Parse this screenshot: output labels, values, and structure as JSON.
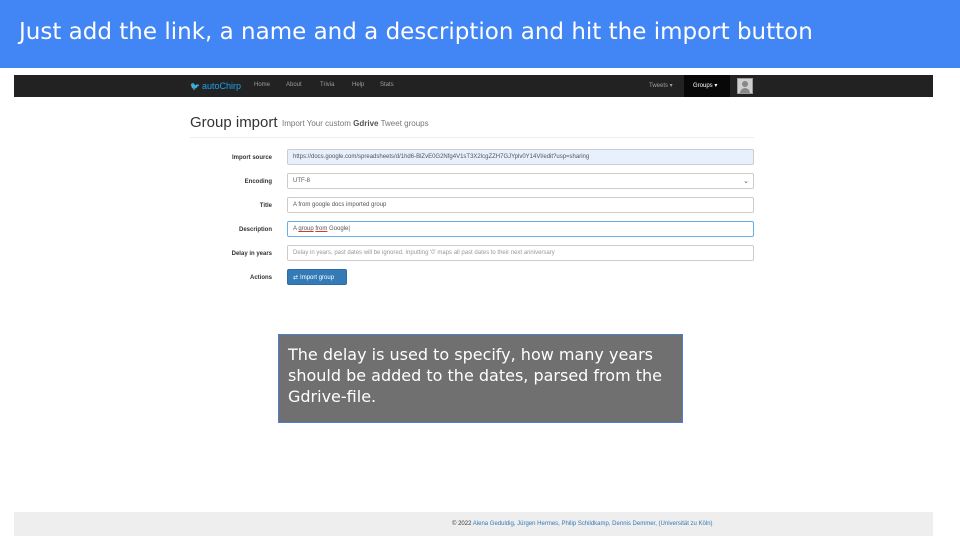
{
  "slide": {
    "title": "Just add the link, a name and a description and hit the import button",
    "note": "The delay is used to specify, how many years\nshould be added to the dates, parsed from the\nGdrive-file."
  },
  "navbar": {
    "brand": "autoChirp",
    "links": [
      "Home",
      "About",
      "Trivia",
      "Help",
      "Stats"
    ],
    "tweets": "Tweets ▾",
    "groups": "Groups ▾"
  },
  "page": {
    "title": "Group import",
    "subtitle_prefix": "Import Your custom ",
    "subtitle_bold": "Gdrive",
    "subtitle_suffix": " Tweet groups"
  },
  "form": {
    "import_source_label": "Import source",
    "import_source_value": "https://docs.google.com/spreadsheets/d/1hd6-BlZvE0G2Nfg4V1sT3X2lcgZZH7GJYplv0Y14Vl/edit?usp=sharing",
    "encoding_label": "Encoding",
    "encoding_value": "UTF-8",
    "title_label": "Title",
    "title_value": "A from google docs imported group",
    "description_label": "Description",
    "description_value_a": "A ",
    "description_value_b": "group",
    "description_value_c": " ",
    "description_value_d": "from",
    "description_value_e": " Google",
    "delay_label": "Delay in years",
    "delay_placeholder": "Delay in years, past dates will be ignored. Inputting '0' maps all past dates to their next anniversary",
    "actions_label": "Actions",
    "import_button": "Import group"
  },
  "footer": {
    "prefix": "© 2022 ",
    "names": "Alena Geduldig, Jürgen Hermes, Philip Schildkamp, Dennis Demmer,",
    "suffix": " (Universität zu Köln)"
  },
  "colors": {
    "header_blue": "#4285f4",
    "navbar": "#222222",
    "button_primary": "#337ab7",
    "note_gray": "#707070"
  }
}
